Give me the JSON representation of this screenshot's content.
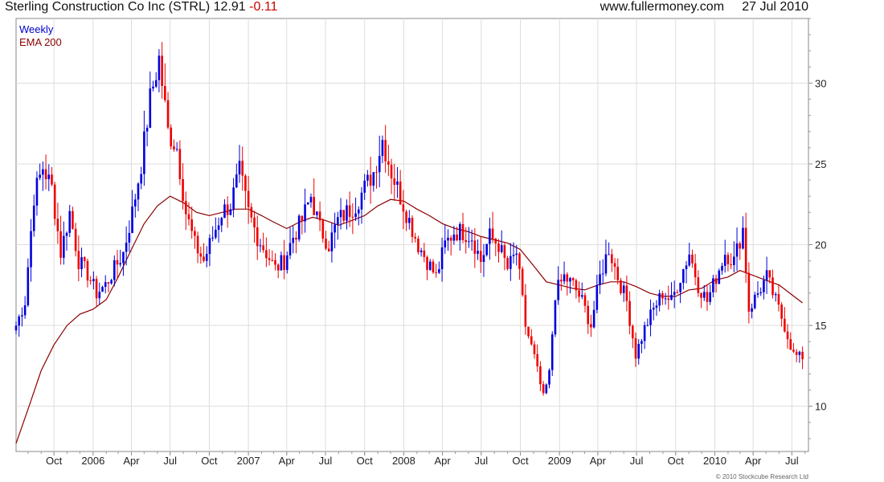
{
  "header": {
    "title": "Sterling Construction Co Inc (STRL)",
    "last": "12.91",
    "change": "-0.11",
    "site": "www.fullermoney.com",
    "date": "27 Jul 2010"
  },
  "legend": {
    "period": "Weekly",
    "indicator": "EMA 200"
  },
  "copyright": "© 2010 Stockcube Research Ltd",
  "colors": {
    "up": "#0000dd",
    "down": "#ee0000",
    "ema": "#8b0000",
    "grid": "#dddddd"
  },
  "chart_data": {
    "type": "candlestick",
    "period": "weekly",
    "x_tick_labels": [
      "Oct",
      "2006",
      "Apr",
      "Jul",
      "Oct",
      "2007",
      "Apr",
      "Jul",
      "Oct",
      "2008",
      "Apr",
      "Jul",
      "Oct",
      "2009",
      "Apr",
      "Jul",
      "Oct",
      "2010",
      "Apr",
      "Jul"
    ],
    "y_ticks": [
      10,
      15,
      20,
      25,
      30
    ],
    "ylim": [
      7.2,
      34
    ],
    "xlim": [
      "2005-07-04",
      "2010-08-09"
    ],
    "grid": true,
    "y_axis_side": "right",
    "series": [
      {
        "name": "EMA 200",
        "type": "line",
        "points": [
          [
            "2005-07-04",
            7.7
          ],
          [
            "2005-08-01",
            9.8
          ],
          [
            "2005-09-01",
            12.2
          ],
          [
            "2005-10-01",
            13.8
          ],
          [
            "2005-11-01",
            15.0
          ],
          [
            "2005-12-01",
            15.7
          ],
          [
            "2006-01-01",
            16.0
          ],
          [
            "2006-02-01",
            16.6
          ],
          [
            "2006-03-01",
            18.0
          ],
          [
            "2006-04-01",
            19.7
          ],
          [
            "2006-05-01",
            21.3
          ],
          [
            "2006-06-01",
            22.4
          ],
          [
            "2006-07-01",
            23.0
          ],
          [
            "2006-08-01",
            22.6
          ],
          [
            "2006-09-01",
            22.0
          ],
          [
            "2006-10-01",
            21.8
          ],
          [
            "2006-11-01",
            22.0
          ],
          [
            "2006-12-01",
            22.2
          ],
          [
            "2007-01-01",
            22.2
          ],
          [
            "2007-02-01",
            21.8
          ],
          [
            "2007-03-01",
            21.4
          ],
          [
            "2007-04-01",
            21.0
          ],
          [
            "2007-05-01",
            21.4
          ],
          [
            "2007-06-01",
            21.7
          ],
          [
            "2007-07-01",
            21.5
          ],
          [
            "2007-08-01",
            21.2
          ],
          [
            "2007-09-01",
            21.5
          ],
          [
            "2007-10-01",
            21.8
          ],
          [
            "2007-11-01",
            22.4
          ],
          [
            "2007-12-01",
            22.8
          ],
          [
            "2008-01-01",
            22.7
          ],
          [
            "2008-02-01",
            22.2
          ],
          [
            "2008-03-01",
            21.8
          ],
          [
            "2008-04-01",
            21.3
          ],
          [
            "2008-05-01",
            21.0
          ],
          [
            "2008-06-01",
            20.8
          ],
          [
            "2008-07-01",
            20.5
          ],
          [
            "2008-08-01",
            20.3
          ],
          [
            "2008-09-01",
            20.1
          ],
          [
            "2008-10-01",
            19.7
          ],
          [
            "2008-11-01",
            18.7
          ],
          [
            "2008-12-01",
            17.7
          ],
          [
            "2009-01-01",
            17.5
          ],
          [
            "2009-02-01",
            17.3
          ],
          [
            "2009-03-01",
            17.2
          ],
          [
            "2009-04-01",
            17.5
          ],
          [
            "2009-05-01",
            17.7
          ],
          [
            "2009-06-01",
            17.7
          ],
          [
            "2009-07-01",
            17.4
          ],
          [
            "2009-08-01",
            17.0
          ],
          [
            "2009-09-01",
            16.8
          ],
          [
            "2009-10-01",
            16.8
          ],
          [
            "2009-11-01",
            17.2
          ],
          [
            "2009-12-01",
            17.3
          ],
          [
            "2010-01-01",
            17.8
          ],
          [
            "2010-02-01",
            18.0
          ],
          [
            "2010-03-01",
            18.4
          ],
          [
            "2010-04-01",
            18.1
          ],
          [
            "2010-05-01",
            17.8
          ],
          [
            "2010-06-01",
            17.5
          ],
          [
            "2010-07-01",
            16.9
          ],
          [
            "2010-07-26",
            16.4
          ]
        ]
      },
      {
        "name": "Weekly",
        "type": "candles",
        "anchors_close": [
          [
            "2005-07-04",
            15.0
          ],
          [
            "2005-07-25",
            16.5
          ],
          [
            "2005-08-15",
            23.0
          ],
          [
            "2005-09-05",
            24.8
          ],
          [
            "2005-09-26",
            23.5
          ],
          [
            "2005-10-17",
            19.5
          ],
          [
            "2005-11-07",
            22.0
          ],
          [
            "2005-11-28",
            19.0
          ],
          [
            "2005-12-19",
            18.2
          ],
          [
            "2006-01-09",
            17.0
          ],
          [
            "2006-01-30",
            17.5
          ],
          [
            "2006-02-20",
            18.5
          ],
          [
            "2006-03-13",
            19.5
          ],
          [
            "2006-04-03",
            22.0
          ],
          [
            "2006-04-24",
            25.0
          ],
          [
            "2006-05-15",
            29.0
          ],
          [
            "2006-06-05",
            31.5
          ],
          [
            "2006-06-26",
            27.0
          ],
          [
            "2006-07-17",
            26.0
          ],
          [
            "2006-08-07",
            22.0
          ],
          [
            "2006-08-28",
            20.0
          ],
          [
            "2006-09-18",
            19.0
          ],
          [
            "2006-10-09",
            20.5
          ],
          [
            "2006-10-30",
            22.0
          ],
          [
            "2006-11-20",
            22.5
          ],
          [
            "2006-12-11",
            24.5
          ],
          [
            "2007-01-01",
            22.0
          ],
          [
            "2007-01-22",
            20.5
          ],
          [
            "2007-02-12",
            19.5
          ],
          [
            "2007-03-05",
            18.5
          ],
          [
            "2007-03-26",
            19.0
          ],
          [
            "2007-04-16",
            20.5
          ],
          [
            "2007-05-07",
            21.5
          ],
          [
            "2007-05-28",
            23.0
          ],
          [
            "2007-06-18",
            21.0
          ],
          [
            "2007-07-09",
            20.0
          ],
          [
            "2007-07-30",
            21.5
          ],
          [
            "2007-08-20",
            22.0
          ],
          [
            "2007-09-10",
            22.5
          ],
          [
            "2007-10-01",
            23.5
          ],
          [
            "2007-10-22",
            24.5
          ],
          [
            "2007-11-12",
            26.5
          ],
          [
            "2007-12-03",
            24.5
          ],
          [
            "2007-12-24",
            23.0
          ],
          [
            "2008-01-14",
            21.5
          ],
          [
            "2008-02-04",
            20.0
          ],
          [
            "2008-02-25",
            19.0
          ],
          [
            "2008-03-17",
            18.0
          ],
          [
            "2008-04-07",
            20.0
          ],
          [
            "2008-04-28",
            20.8
          ],
          [
            "2008-05-19",
            20.8
          ],
          [
            "2008-06-09",
            20.5
          ],
          [
            "2008-06-30",
            19.0
          ],
          [
            "2008-07-21",
            20.5
          ],
          [
            "2008-08-11",
            20.0
          ],
          [
            "2008-09-01",
            18.5
          ],
          [
            "2008-09-22",
            19.5
          ],
          [
            "2008-10-13",
            15.0
          ],
          [
            "2008-11-03",
            13.0
          ],
          [
            "2008-11-24",
            10.5
          ],
          [
            "2008-12-08",
            12.0
          ],
          [
            "2008-12-22",
            17.0
          ],
          [
            "2009-01-12",
            18.0
          ],
          [
            "2009-02-02",
            17.5
          ],
          [
            "2009-02-23",
            16.5
          ],
          [
            "2009-03-16",
            15.0
          ],
          [
            "2009-04-06",
            18.0
          ],
          [
            "2009-04-27",
            19.8
          ],
          [
            "2009-05-18",
            18.0
          ],
          [
            "2009-06-08",
            16.5
          ],
          [
            "2009-06-29",
            13.2
          ],
          [
            "2009-07-20",
            14.8
          ],
          [
            "2009-08-10",
            16.0
          ],
          [
            "2009-08-31",
            17.0
          ],
          [
            "2009-09-21",
            16.5
          ],
          [
            "2009-10-12",
            18.0
          ],
          [
            "2009-11-02",
            19.5
          ],
          [
            "2009-11-23",
            17.5
          ],
          [
            "2009-12-14",
            16.5
          ],
          [
            "2010-01-04",
            18.0
          ],
          [
            "2010-01-25",
            19.5
          ],
          [
            "2010-02-15",
            19.0
          ],
          [
            "2010-03-08",
            21.0
          ],
          [
            "2010-03-22",
            16.0
          ],
          [
            "2010-04-12",
            17.0
          ],
          [
            "2010-05-03",
            18.0
          ],
          [
            "2010-05-24",
            16.5
          ],
          [
            "2010-06-14",
            15.0
          ],
          [
            "2010-07-05",
            13.2
          ],
          [
            "2010-07-26",
            12.91
          ]
        ]
      }
    ]
  }
}
